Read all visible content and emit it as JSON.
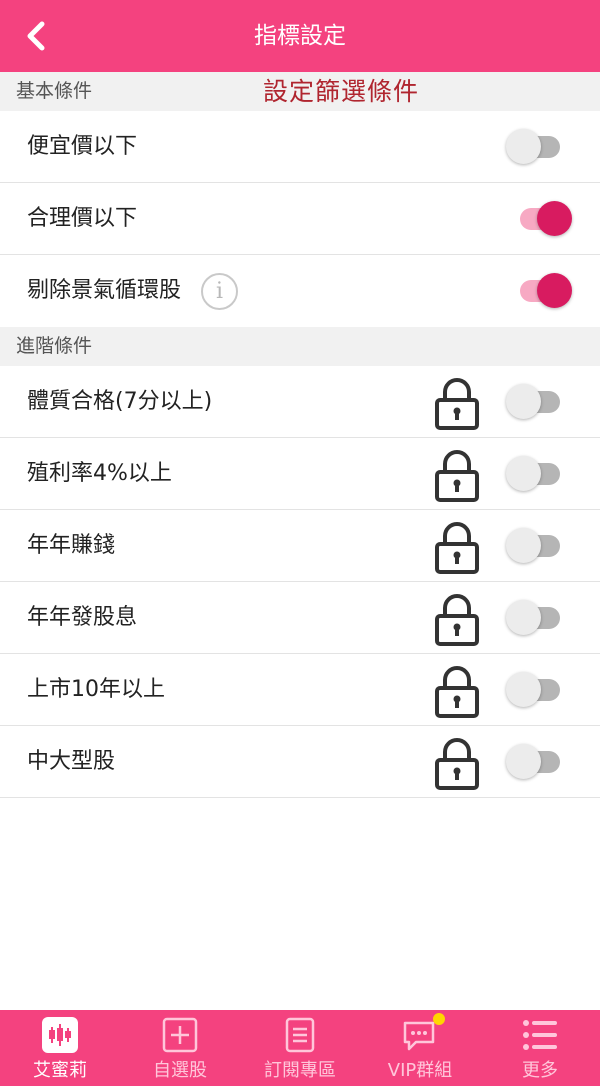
{
  "header": {
    "title": "指標設定"
  },
  "basic": {
    "label": "基本條件",
    "annotation": "設定篩選條件",
    "items": [
      {
        "label": "便宜價以下",
        "enabled": false
      },
      {
        "label": "合理價以下",
        "enabled": true
      },
      {
        "label": "剔除景氣循環股",
        "enabled": true,
        "info_glyph": "i"
      }
    ]
  },
  "advanced": {
    "label": "進階條件",
    "items": [
      {
        "label": "體質合格(7分以上)",
        "enabled": false,
        "locked": true
      },
      {
        "label": "殖利率4%以上",
        "enabled": false,
        "locked": true
      },
      {
        "label": "年年賺錢",
        "enabled": false,
        "locked": true
      },
      {
        "label": "年年發股息",
        "enabled": false,
        "locked": true
      },
      {
        "label": "上市10年以上",
        "enabled": false,
        "locked": true
      },
      {
        "label": "中大型股",
        "enabled": false,
        "locked": true
      }
    ]
  },
  "tabs": [
    {
      "label": "艾蜜莉",
      "icon": "candlestick-icon",
      "active": true
    },
    {
      "label": "自選股",
      "icon": "plus-square-icon",
      "active": false
    },
    {
      "label": "訂閱專區",
      "icon": "document-list-icon",
      "active": false
    },
    {
      "label": "VIP群組",
      "icon": "chat-bubble-icon",
      "active": false,
      "badge_dot": true
    },
    {
      "label": "更多",
      "icon": "menu-list-icon",
      "active": false
    }
  ],
  "colors": {
    "primary": "#f4427f",
    "toggle_on": "#d81b60",
    "annotation": "#b0252f",
    "badge": "#ffd600"
  }
}
